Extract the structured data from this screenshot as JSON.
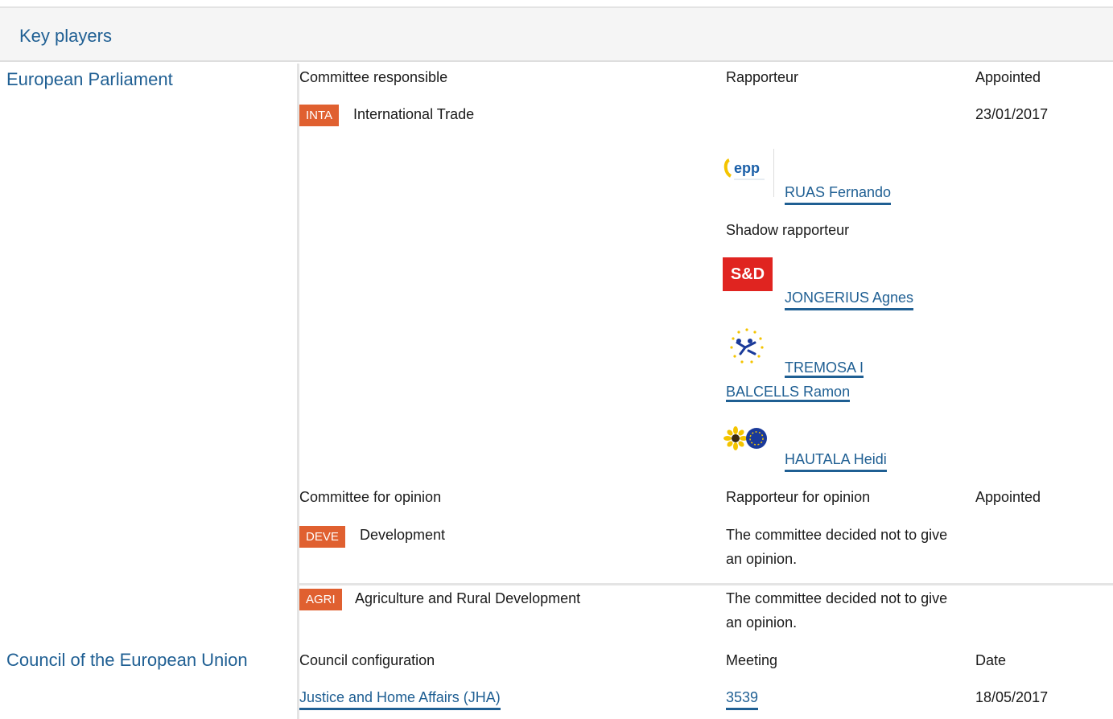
{
  "header": {
    "title": "Key players"
  },
  "ep": {
    "name": "European Parliament",
    "col_committee": "Committee responsible",
    "col_rapporteur": "Rapporteur",
    "col_appointed": "Appointed",
    "lead": {
      "code": "INTA",
      "name": "International Trade",
      "date": "23/01/2017"
    },
    "rapporteur": {
      "name": "RUAS Fernando",
      "group_icon": "epp-logo",
      "logo_text": "epp"
    },
    "shadow_label": "Shadow rapporteur",
    "shadows": [
      {
        "name": "JONGERIUS Agnes",
        "group_icon": "s-and-d-logo",
        "logo_text": "S&D"
      },
      {
        "name": "TREMOSA I BALCELLS Ramon",
        "group_icon": "alde-logo"
      },
      {
        "name": "HAUTALA Heidi",
        "group_icon": "greens-efa-logo"
      }
    ],
    "col_opinion": "Committee for opinion",
    "col_rapporteur_opinion": "Rapporteur for opinion",
    "col_appointed_opinion": "Appointed",
    "opinions": [
      {
        "code": "DEVE",
        "name": "Development",
        "note": "The committee decided not to give an opinion."
      },
      {
        "code": "AGRI",
        "name": "Agriculture and Rural Development",
        "note": "The committee decided not to give an opinion."
      }
    ]
  },
  "council": {
    "name": "Council of the European Union",
    "col_config": "Council configuration",
    "col_meeting": "Meeting",
    "col_date": "Date",
    "config": "Justice and Home Affairs (JHA)",
    "meeting": "3539",
    "date": "18/05/2017"
  },
  "colors": {
    "link": "#1f5f93",
    "badge": "#e06030",
    "sd_red": "#e02420"
  }
}
